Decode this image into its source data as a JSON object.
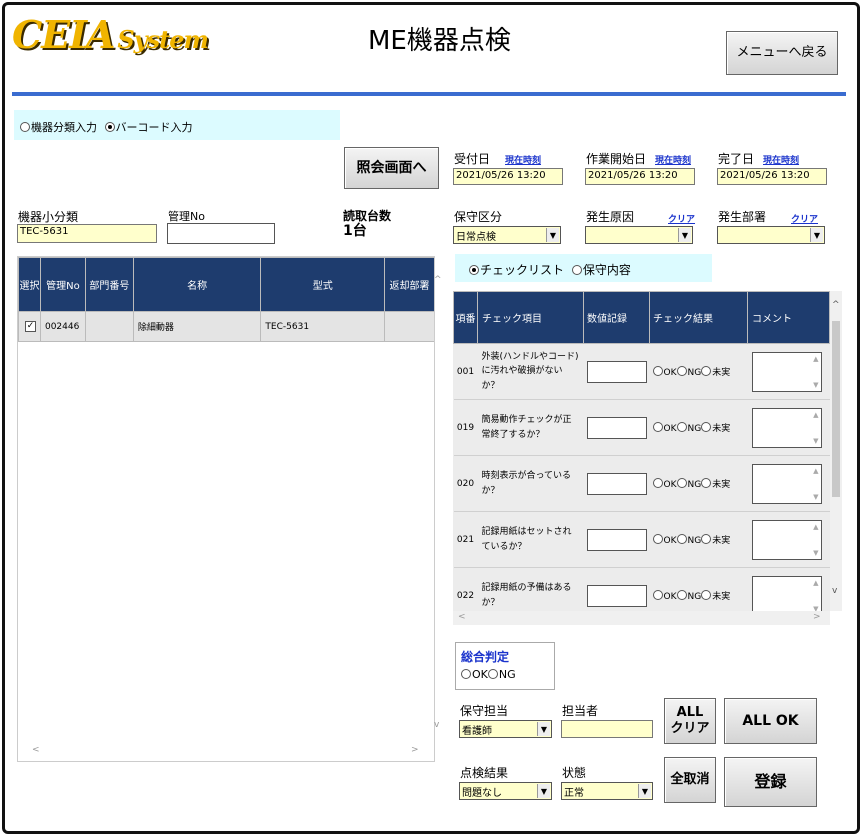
{
  "header": {
    "logo_main": "CEIA",
    "logo_sub": "System",
    "title": "ME機器点検",
    "menu_back_label": "メニューへ戻る"
  },
  "input_mode": {
    "option_category": "機器分類入力",
    "option_barcode": "バーコード入力",
    "selected": "barcode"
  },
  "inquiry_button_label": "照会画面へ",
  "received": {
    "label": "受付日",
    "now_label": "現在時刻",
    "value": "2021/05/26 13:20"
  },
  "work_start": {
    "label": "作業開始日",
    "now_label": "現在時刻",
    "value": "2021/05/26 13:20"
  },
  "completed": {
    "label": "完了日",
    "now_label": "現在時刻",
    "value": "2021/05/26 13:20"
  },
  "device_subcategory": {
    "label": "機器小分類",
    "value": "TEC-5631"
  },
  "management_no": {
    "label": "管理No",
    "value": ""
  },
  "read_count": {
    "label": "読取台数",
    "value": "1台"
  },
  "maintenance_type": {
    "label": "保守区分",
    "value": "日常点検"
  },
  "cause": {
    "label": "発生原因",
    "clear_label": "クリア",
    "value": ""
  },
  "dept": {
    "label": "発生部署",
    "clear_label": "クリア",
    "value": ""
  },
  "device_table": {
    "headers": [
      "選択",
      "管理No",
      "部門番号",
      "名称",
      "型式",
      "返却部署"
    ],
    "rows": [
      {
        "checked": "✓",
        "management_no": "002446",
        "dept_no": "",
        "name": "除細動器",
        "model": "TEC-5631",
        "return_dept": ""
      }
    ]
  },
  "check_mode": {
    "option_checklist": "チェックリスト",
    "option_content": "保守内容",
    "selected": "checklist"
  },
  "checklist_table": {
    "headers": [
      "項番",
      "チェック項目",
      "数値記録",
      "チェック結果",
      "コメント"
    ],
    "result_options": [
      "OK",
      "NG",
      "未実"
    ],
    "rows": [
      {
        "no": "001",
        "item": "外装(ハンドルやコード)に汚れや破損がないか？"
      },
      {
        "no": "019",
        "item": "簡易動作チェックが正常終了するか？"
      },
      {
        "no": "020",
        "item": "時刻表示が合っているか？"
      },
      {
        "no": "021",
        "item": "記録用紙はセットされているか？"
      },
      {
        "no": "022",
        "item": "記録用紙の予備はあるか？"
      }
    ]
  },
  "overall": {
    "label": "総合判定",
    "option_ok": "OK",
    "option_ng": "NG"
  },
  "maintenance_person": {
    "label": "保守担当",
    "value": "看護師"
  },
  "person_in_charge": {
    "label": "担当者",
    "value": ""
  },
  "inspection_result": {
    "label": "点検結果",
    "value": "問題なし"
  },
  "status": {
    "label": "状態",
    "value": "正常"
  },
  "buttons": {
    "all_clear_line1": "ALL",
    "all_clear_line2": "クリア",
    "all_ok": "ALL OK",
    "cancel_all": "全取消",
    "register": "登録"
  }
}
